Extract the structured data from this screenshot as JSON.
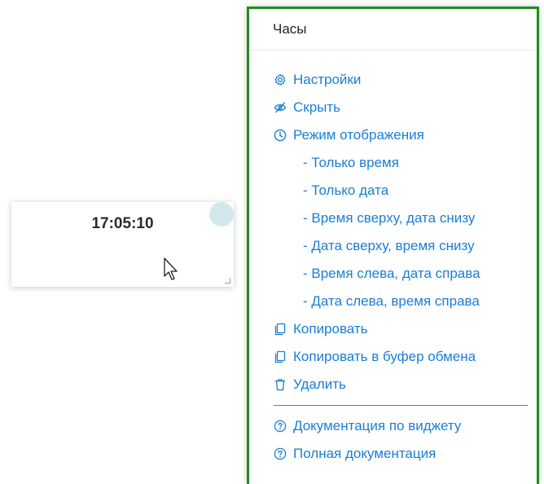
{
  "widget": {
    "time": "17:05:10"
  },
  "menu": {
    "title": "Часы",
    "items": [
      {
        "label": "Настройки",
        "icon": "gear-icon"
      },
      {
        "label": "Скрыть",
        "icon": "eye-slash-icon"
      },
      {
        "label": "Режим отображения",
        "icon": "clock-icon"
      }
    ],
    "display_modes": [
      "- Только время",
      "- Только дата",
      "- Время сверху, дата снизу",
      "- Дата сверху, время снизу",
      "- Время слева, дата справа",
      "- Дата слева, время справа"
    ],
    "actions": [
      {
        "label": "Копировать",
        "icon": "copy-icon"
      },
      {
        "label": "Копировать в буфер обмена",
        "icon": "copy-icon"
      },
      {
        "label": "Удалить",
        "icon": "trash-icon"
      }
    ],
    "help": [
      {
        "label": "Документация по виджету",
        "icon": "question-circle-icon"
      },
      {
        "label": "Полная документация",
        "icon": "question-circle-icon"
      }
    ]
  },
  "colors": {
    "accent": "#1b7dd4",
    "frame": "#1e8f1e"
  }
}
